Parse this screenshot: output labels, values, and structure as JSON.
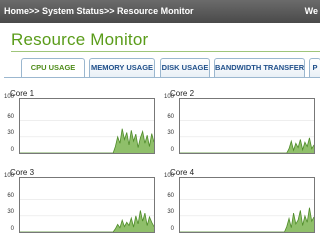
{
  "breadcrumb": "Home>> System Status>> Resource Monitor",
  "topbar_right": "We",
  "page_title": "Resource Monitor",
  "tabs": [
    {
      "label": "CPU USAGE",
      "active": true
    },
    {
      "label": "MEMORY USAGE",
      "active": false
    },
    {
      "label": "DISK USAGE",
      "active": false
    },
    {
      "label": "BANDWIDTH TRANSFER",
      "active": false
    },
    {
      "label": "P",
      "active": false
    }
  ],
  "colors": {
    "accent_green": "#5a9c1a",
    "chart_line": "#4f8c2a",
    "chart_fill": "#8fbf6a",
    "tab_text": "#1f4f8a"
  },
  "chart_data": [
    {
      "type": "area",
      "title": "Core 1",
      "ylim": [
        0,
        100
      ],
      "yticks": [
        0,
        30,
        60,
        100
      ],
      "x": [
        0,
        1,
        2,
        3,
        4,
        5,
        6,
        7,
        8,
        9,
        10,
        11,
        12,
        13,
        14,
        15,
        16,
        17,
        18,
        19,
        20,
        21,
        22,
        23,
        24,
        25,
        26,
        27,
        28,
        29,
        30,
        31,
        32,
        33,
        34,
        35,
        36,
        37,
        38,
        39,
        40,
        41,
        42,
        43,
        44,
        45,
        46,
        47,
        48,
        49,
        50,
        51,
        52,
        53,
        54,
        55,
        56,
        57,
        58,
        59
      ],
      "values": [
        0,
        0,
        0,
        0,
        0,
        0,
        0,
        0,
        0,
        0,
        0,
        0,
        0,
        0,
        0,
        0,
        0,
        0,
        0,
        0,
        0,
        0,
        0,
        0,
        0,
        0,
        0,
        0,
        0,
        0,
        0,
        0,
        0,
        0,
        0,
        0,
        0,
        0,
        0,
        0,
        0,
        0,
        12,
        30,
        18,
        45,
        25,
        38,
        15,
        42,
        22,
        35,
        10,
        28,
        40,
        18,
        33,
        12,
        36,
        20
      ]
    },
    {
      "type": "area",
      "title": "Core 2",
      "ylim": [
        0,
        100
      ],
      "yticks": [
        0,
        30,
        60,
        100
      ],
      "x": [
        0,
        1,
        2,
        3,
        4,
        5,
        6,
        7,
        8,
        9,
        10,
        11,
        12,
        13,
        14,
        15,
        16,
        17,
        18,
        19,
        20,
        21,
        22,
        23,
        24,
        25,
        26,
        27,
        28,
        29,
        30,
        31,
        32,
        33,
        34,
        35,
        36,
        37,
        38,
        39,
        40,
        41,
        42,
        43,
        44,
        45,
        46,
        47,
        48,
        49,
        50,
        51,
        52,
        53,
        54,
        55,
        56,
        57,
        58,
        59
      ],
      "values": [
        0,
        0,
        0,
        0,
        0,
        0,
        0,
        0,
        0,
        0,
        0,
        0,
        0,
        0,
        0,
        0,
        0,
        0,
        0,
        0,
        0,
        0,
        0,
        0,
        0,
        0,
        0,
        0,
        0,
        0,
        0,
        0,
        0,
        0,
        0,
        0,
        0,
        0,
        0,
        0,
        0,
        0,
        0,
        0,
        0,
        0,
        0,
        0,
        8,
        22,
        5,
        18,
        10,
        25,
        6,
        20,
        12,
        28,
        8,
        15
      ]
    },
    {
      "type": "area",
      "title": "Core 3",
      "ylim": [
        0,
        100
      ],
      "yticks": [
        0,
        30,
        60,
        100
      ],
      "x": [
        0,
        1,
        2,
        3,
        4,
        5,
        6,
        7,
        8,
        9,
        10,
        11,
        12,
        13,
        14,
        15,
        16,
        17,
        18,
        19,
        20,
        21,
        22,
        23,
        24,
        25,
        26,
        27,
        28,
        29,
        30,
        31,
        32,
        33,
        34,
        35,
        36,
        37,
        38,
        39,
        40,
        41,
        42,
        43,
        44,
        45,
        46,
        47,
        48,
        49,
        50,
        51,
        52,
        53,
        54,
        55,
        56,
        57,
        58,
        59
      ],
      "values": [
        0,
        0,
        0,
        0,
        0,
        0,
        0,
        0,
        0,
        0,
        0,
        0,
        0,
        0,
        0,
        0,
        0,
        0,
        0,
        0,
        0,
        0,
        0,
        0,
        0,
        0,
        0,
        0,
        0,
        0,
        0,
        0,
        0,
        0,
        0,
        0,
        0,
        0,
        0,
        0,
        0,
        0,
        6,
        14,
        8,
        22,
        10,
        18,
        12,
        26,
        9,
        30,
        15,
        40,
        20,
        35,
        12,
        28,
        18,
        10
      ]
    },
    {
      "type": "area",
      "title": "Core 4",
      "ylim": [
        0,
        100
      ],
      "yticks": [
        0,
        30,
        60,
        100
      ],
      "x": [
        0,
        1,
        2,
        3,
        4,
        5,
        6,
        7,
        8,
        9,
        10,
        11,
        12,
        13,
        14,
        15,
        16,
        17,
        18,
        19,
        20,
        21,
        22,
        23,
        24,
        25,
        26,
        27,
        28,
        29,
        30,
        31,
        32,
        33,
        34,
        35,
        36,
        37,
        38,
        39,
        40,
        41,
        42,
        43,
        44,
        45,
        46,
        47,
        48,
        49,
        50,
        51,
        52,
        53,
        54,
        55,
        56,
        57,
        58,
        59
      ],
      "values": [
        0,
        0,
        0,
        0,
        0,
        0,
        0,
        0,
        0,
        0,
        0,
        0,
        0,
        0,
        0,
        0,
        0,
        0,
        0,
        0,
        0,
        0,
        0,
        0,
        0,
        0,
        0,
        0,
        0,
        0,
        0,
        0,
        0,
        0,
        0,
        0,
        0,
        0,
        0,
        0,
        0,
        0,
        0,
        0,
        0,
        0,
        0,
        10,
        25,
        8,
        35,
        15,
        22,
        40,
        12,
        30,
        18,
        45,
        20,
        28
      ]
    }
  ]
}
